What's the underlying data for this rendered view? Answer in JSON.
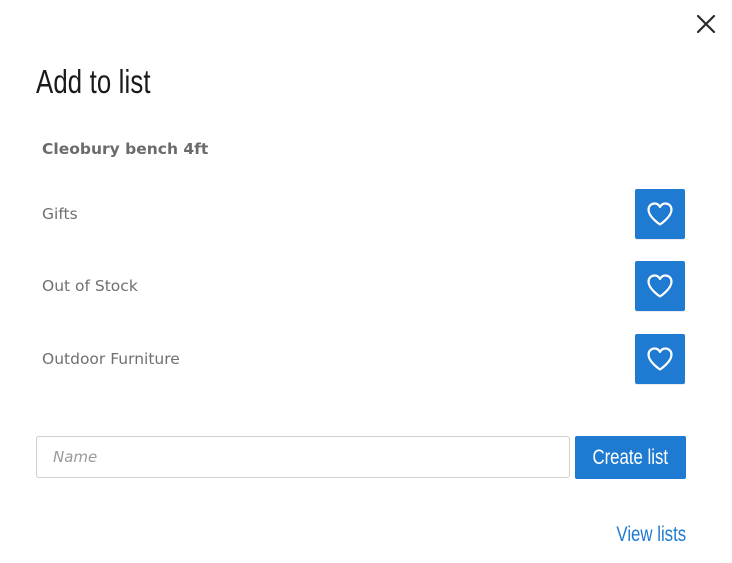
{
  "dialog": {
    "title": "Add to list",
    "close_icon": "close-icon"
  },
  "product": {
    "name": "Cleobury bench 4ft"
  },
  "lists": [
    {
      "label": "Gifts",
      "icon": "heart-outline-icon"
    },
    {
      "label": "Out of Stock",
      "icon": "heart-outline-icon"
    },
    {
      "label": "Outdoor Furniture",
      "icon": "heart-outline-icon"
    }
  ],
  "new_list": {
    "placeholder": "Name",
    "value": "",
    "create_label": "Create list"
  },
  "footer": {
    "view_lists_label": "View lists"
  },
  "colors": {
    "accent": "#1f7ad1",
    "title_text": "#1a1a1a",
    "muted_text": "#707070"
  }
}
